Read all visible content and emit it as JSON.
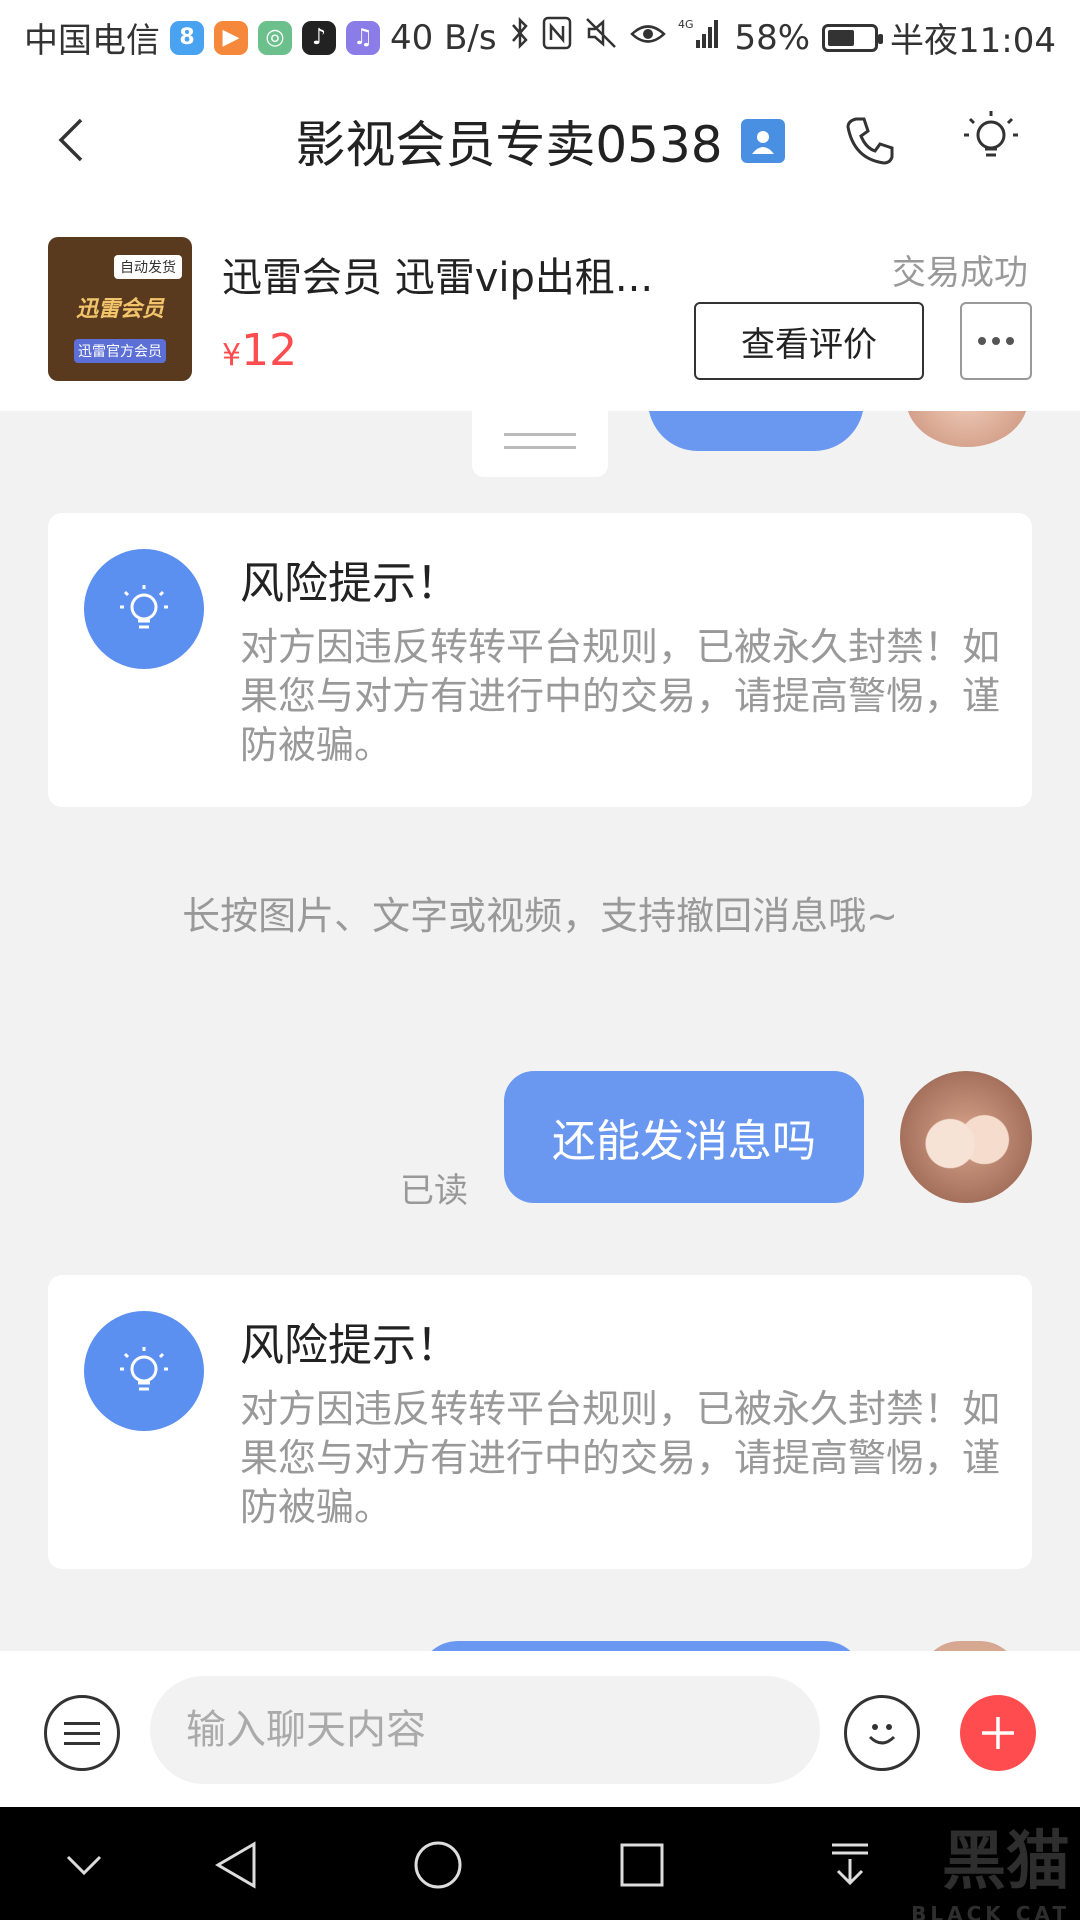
{
  "status_bar": {
    "carrier": "中国电信",
    "app_icons": [
      "8",
      "▶",
      "◎",
      "♪",
      "♫"
    ],
    "net_speed": "40 B/s",
    "signal": "4G",
    "battery": "58%",
    "battery_level": 0.58,
    "time": "半夜11:04"
  },
  "header": {
    "title": "影视会员专卖0538",
    "icons": [
      "back-icon",
      "contact-icon",
      "phone-icon",
      "bulb-icon"
    ]
  },
  "product": {
    "title": "迅雷会员 迅雷vip出租...",
    "currency": "¥",
    "price": "12",
    "status": "交易成功",
    "review_button": "查看评价",
    "thumb_tag": "自动发货",
    "thumb_logo": "迅雷会员",
    "thumb_footer": "迅雷官方会员"
  },
  "chat": {
    "risk_title": "风险提示！",
    "risk_text": "对方因违反转转平台规则，已被永久封禁！如果您与对方有进行中的交易，请提高警惕，谨防被骗。",
    "system_tip": "长按图片、文字或视频，支持撤回消息哦~",
    "my_message": "还能发消息吗",
    "read_status": "已读"
  },
  "input_bar": {
    "placeholder": "输入聊天内容"
  },
  "watermark": {
    "text": "黑猫",
    "sub": "BLACK CAT"
  },
  "colors": {
    "accent_blue": "#6a98f0",
    "price_red": "#ff4d4f",
    "plus_red": "#ff4d4f"
  }
}
